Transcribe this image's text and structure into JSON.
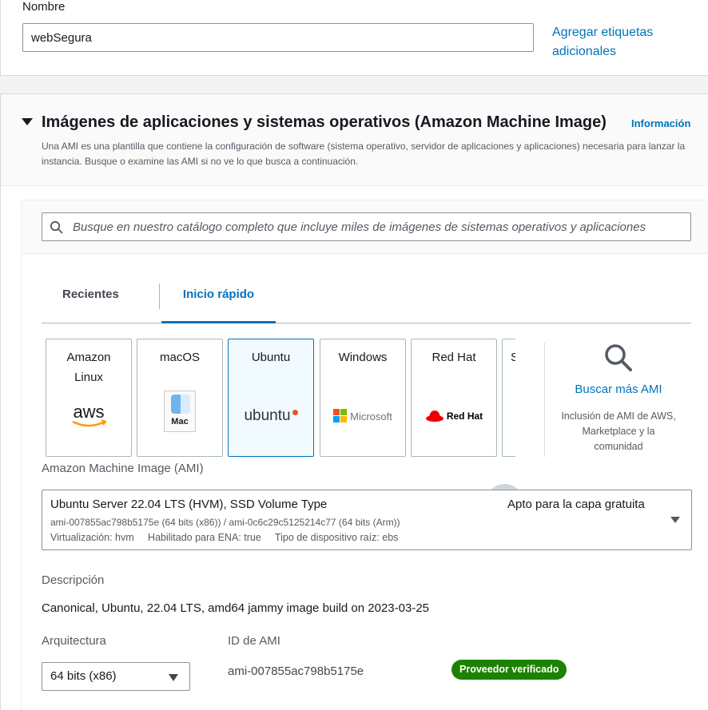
{
  "name_section": {
    "label": "Nombre",
    "value": "webSegura",
    "add_tags_link": "Agregar etiquetas adicionales"
  },
  "ami_section": {
    "title": "Imágenes de aplicaciones y sistemas operativos (Amazon Machine Image)",
    "info_link": "Información",
    "description": "Una AMI es una plantilla que contiene la configuración de software (sistema operativo, servidor de aplicaciones y aplicaciones) necesaria para lanzar la instancia. Busque o examine las AMI si no ve lo que busca a continuación.",
    "search_placeholder": "Busque en nuestro catálogo completo que incluye miles de imágenes de sistemas operativos y aplicaciones",
    "tabs": [
      {
        "label": "Recientes",
        "active": false
      },
      {
        "label": "Inicio rápido",
        "active": true
      }
    ],
    "os_cards": [
      {
        "label": "Amazon Linux",
        "logo_text": "aws",
        "icon": "aws-logo-icon",
        "selected": false
      },
      {
        "label": "macOS",
        "logo_text": "Mac",
        "icon": "mac-finder-icon",
        "selected": false
      },
      {
        "label": "Ubuntu",
        "logo_text": "ubuntu",
        "icon": "ubuntu-logo-icon",
        "selected": true
      },
      {
        "label": "Windows",
        "logo_text": "Microsoft",
        "icon": "microsoft-logo-icon",
        "selected": false
      },
      {
        "label": "Red Hat",
        "logo_text": "Red Hat",
        "icon": "redhat-logo-icon",
        "selected": false
      },
      {
        "label": "S",
        "logo_text": "",
        "icon": "",
        "selected": false
      }
    ],
    "more_ami": {
      "title": "Buscar más AMI",
      "subtitle": "Inclusión de AMI de AWS, Marketplace y la comunidad"
    }
  },
  "ami_select": {
    "label": "Amazon Machine Image (AMI)",
    "name": "Ubuntu Server 22.04 LTS (HVM), SSD Volume Type",
    "free_tier": "Apto para la capa gratuita",
    "ids": "ami-007855ac798b5175e (64 bits (x86)) / ami-0c6c29c5125214c77 (64 bits (Arm))",
    "tags": "Virtualización: hvm     Habilitado para ENA: true     Tipo de dispositivo raíz: ebs"
  },
  "details": {
    "description_label": "Descripción",
    "description_value": "Canonical, Ubuntu, 22.04 LTS, amd64 jammy image build on 2023-03-25",
    "architecture_label": "Arquitectura",
    "architecture_value": "64 bits (x86)",
    "ami_id_label": "ID de AMI",
    "ami_id_value": "ami-007855ac798b5175e",
    "verified_badge": "Proveedor verificado"
  },
  "colors": {
    "link": "#0073bb",
    "badge_green": "#1d8102",
    "selected_border": "#0073bb",
    "ubuntu_orange": "#e95420",
    "redhat_red": "#ee0000"
  }
}
